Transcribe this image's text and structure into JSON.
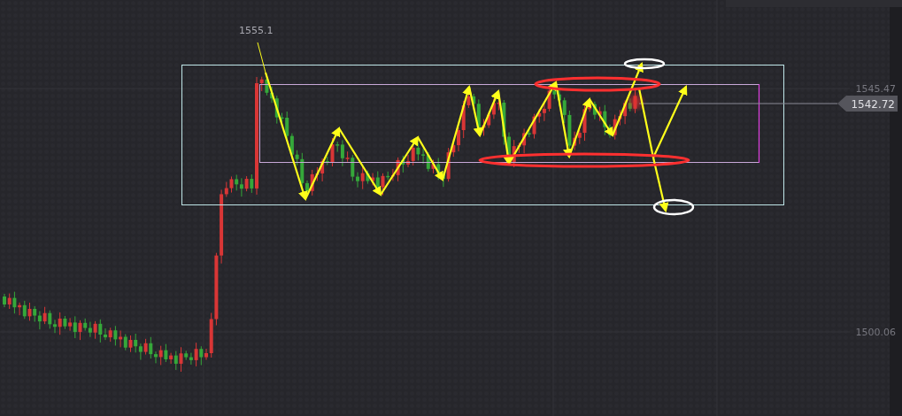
{
  "chart": {
    "high_label": "1555.1",
    "axis_labels": [
      {
        "text": "1545.47"
      },
      {
        "text": "1500.06"
      }
    ],
    "price_tag": "1542.72"
  }
}
